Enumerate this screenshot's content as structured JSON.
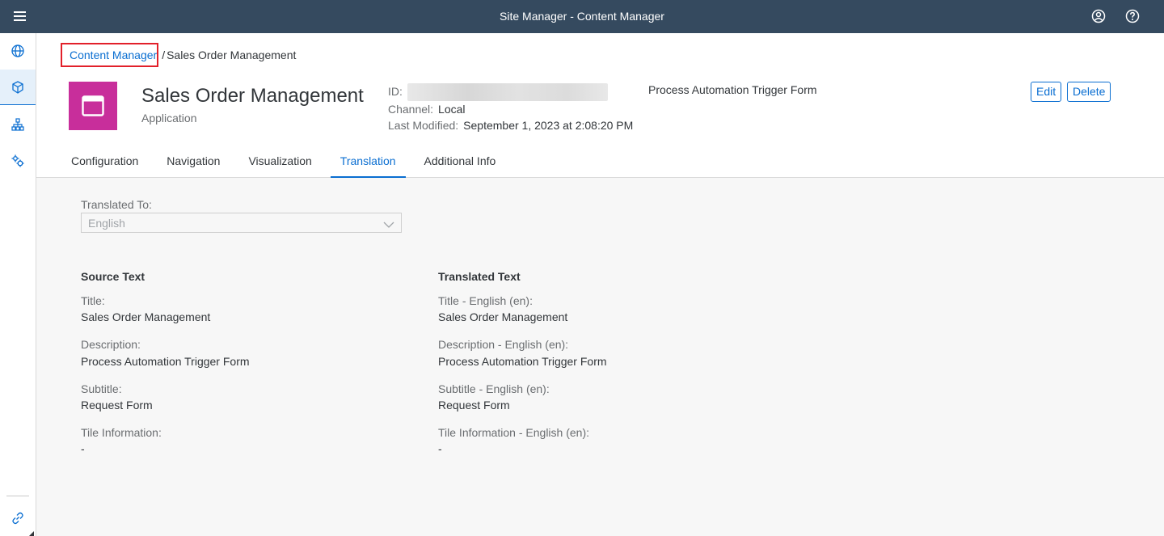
{
  "shell": {
    "title": "Site Manager - Content Manager"
  },
  "breadcrumb": {
    "link": "Content Manager",
    "separator": "/",
    "current": "Sales Order Management"
  },
  "object": {
    "title": "Sales Order Management",
    "subtitle": "Application",
    "id_label": "ID:",
    "channel_label": "Channel:",
    "channel_value": "Local",
    "modified_label": "Last Modified:",
    "modified_value": "September 1, 2023 at 2:08:20 PM",
    "description": "Process Automation Trigger Form",
    "icon_color": "#c82e9b"
  },
  "actions": {
    "edit": "Edit",
    "delete": "Delete"
  },
  "tabs": [
    {
      "label": "Configuration"
    },
    {
      "label": "Navigation"
    },
    {
      "label": "Visualization"
    },
    {
      "label": "Translation",
      "active": true
    },
    {
      "label": "Additional Info"
    }
  ],
  "translation": {
    "translated_to_label": "Translated To:",
    "translated_to_value": "English",
    "source_heading": "Source Text",
    "translated_heading": "Translated Text",
    "source": [
      {
        "label": "Title:",
        "value": "Sales Order Management"
      },
      {
        "label": "Description:",
        "value": "Process Automation Trigger Form"
      },
      {
        "label": "Subtitle:",
        "value": "Request Form"
      },
      {
        "label": "Tile Information:",
        "value": "-"
      }
    ],
    "translated": [
      {
        "label": "Title - English (en):",
        "value": "Sales Order Management"
      },
      {
        "label": "Description - English (en):",
        "value": "Process Automation Trigger Form"
      },
      {
        "label": "Subtitle - English (en):",
        "value": "Request Form"
      },
      {
        "label": "Tile Information - English (en):",
        "value": "-"
      }
    ]
  },
  "colors": {
    "shell": "#354a5f",
    "accent": "#0a6ed1",
    "highlight_box": "#e2202a"
  }
}
